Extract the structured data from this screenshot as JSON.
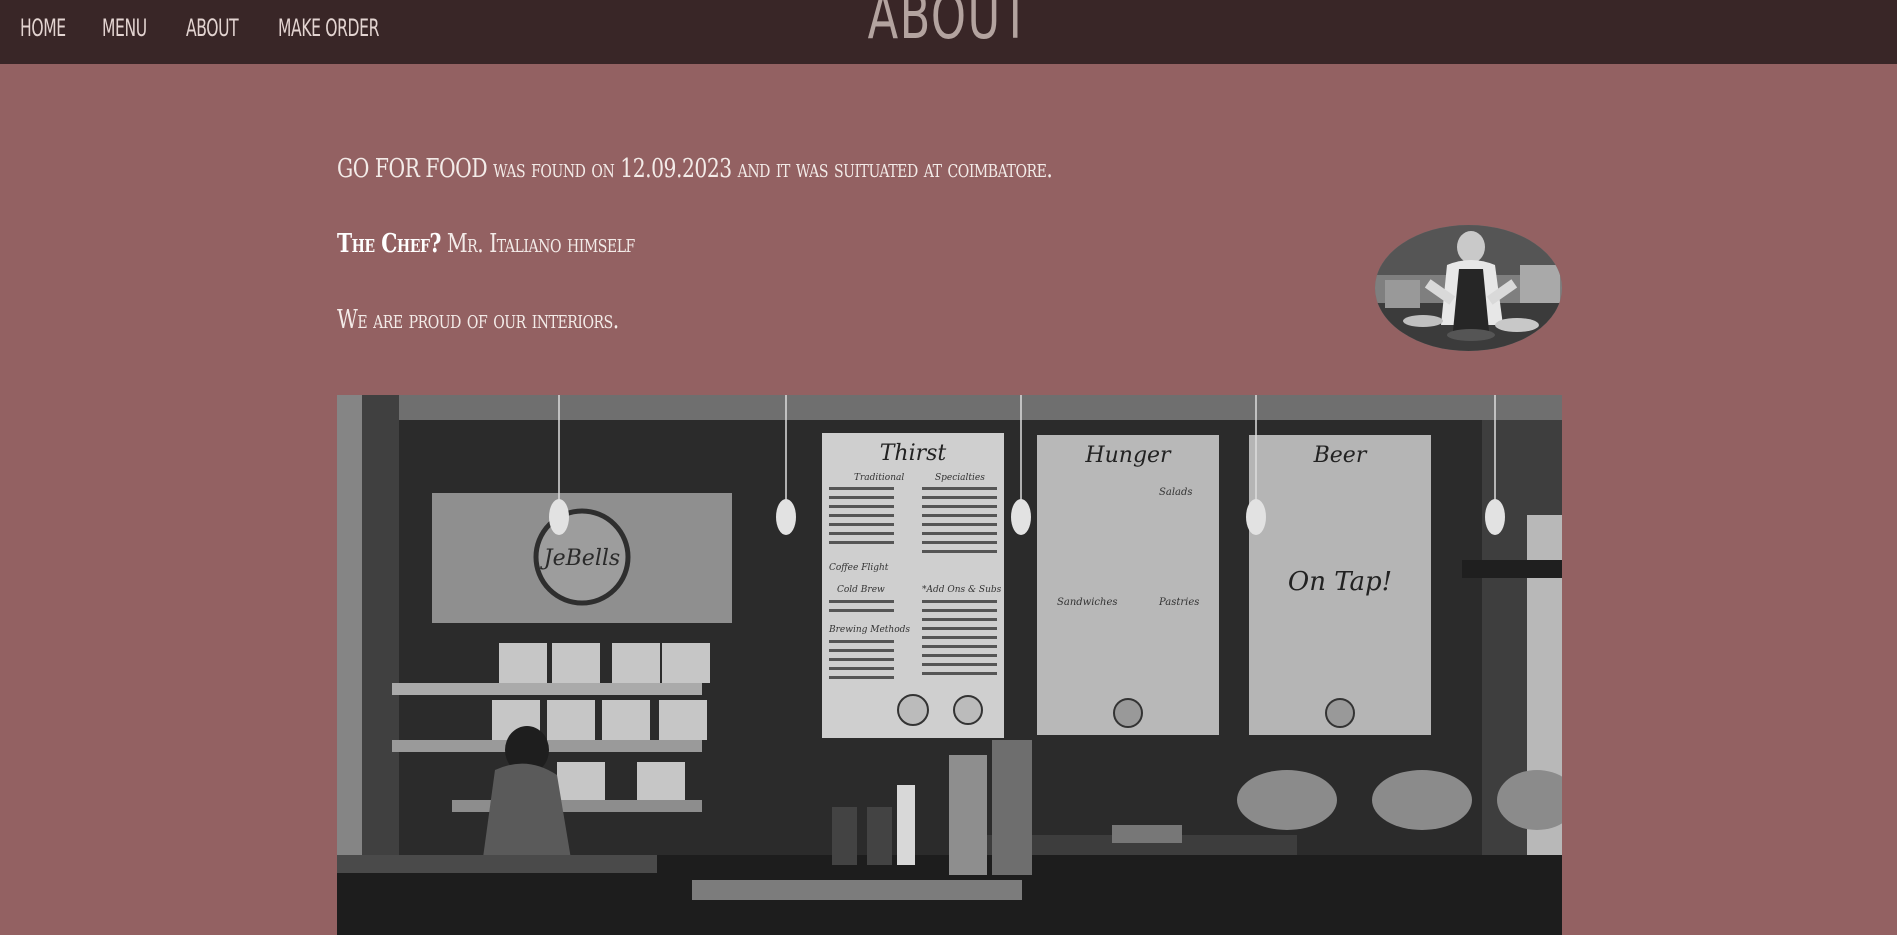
{
  "nav": {
    "items": [
      {
        "label": "HOME"
      },
      {
        "label": "MENU"
      },
      {
        "label": "ABOUT"
      },
      {
        "label": "MAKE ORDER"
      }
    ]
  },
  "header": {
    "title": "ABOUT"
  },
  "main": {
    "founding_text": "GO FOR FOOD was found on 12.09.2023 and it was suituated at coimbatore.",
    "chef_label": "The Chef?",
    "chef_name": " Mr. Italiano himself",
    "interiors_text": "We are proud of our interiors."
  },
  "images": {
    "interior_menu_boards": [
      "Thirst",
      "Hunger",
      "Beer",
      "On Tap!"
    ],
    "thirst_sections": [
      "Traditional",
      "Specialties",
      "Coffee Flight",
      "Cold Brew",
      "*Add Ons & Subs",
      "Brewing Methods"
    ],
    "hunger_sections": [
      "Salads",
      "Sandwiches",
      "Pastries"
    ],
    "logo_text": "JeBells"
  },
  "colors": {
    "background": "#936162",
    "navbar": "#392627",
    "nav_text": "#e3d4d1",
    "title_text": "#b3a39f",
    "body_text": "#f3ebe8"
  }
}
